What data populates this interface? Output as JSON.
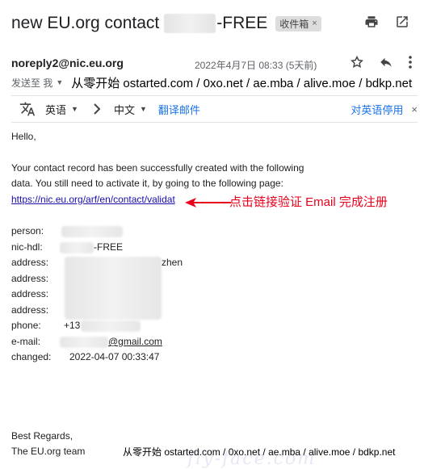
{
  "email": {
    "subject_prefix": "new EU.org contact",
    "subject_suffix": "-FREE",
    "inbox_chip": "收件箱",
    "chip_close": "×",
    "sender": "noreply2@nic.eu.org",
    "date": "2022年4月7日 08:33 (5天前)",
    "to_label": "发送至 我",
    "to_caret": "▼"
  },
  "watermark": {
    "top": "从零开始 ostarted.com / 0xo.net / ae.mba / alive.moe / bdkp.net",
    "bottom": "从零开始 ostarted.com / 0xo.net / ae.mba / alive.moe / bdkp.net",
    "faint": "fly-face.com"
  },
  "translate_bar": {
    "source_lang": "英语",
    "target_lang": "中文",
    "translate_link": "翻译邮件",
    "disable_link": "对英语停用",
    "close": "×"
  },
  "body": {
    "greeting": "Hello,",
    "para_line1": "Your contact record has been successfully created with the following",
    "para_line2": "data. You still need to activate it, by going to the following page:",
    "link": "https://nic.eu.org/arf/en/contact/validat",
    "annotation": "点击链接验证 Email 完成注册"
  },
  "fields": {
    "person_label": "person:",
    "nichdl_label": "nic-hdl:",
    "nichdl_value": "-FREE",
    "address_label": "address:",
    "address1_value": "zhen",
    "phone_label": "phone:",
    "phone_value": "+13",
    "email_label": "e-mail:",
    "email_value": "@gmail.com",
    "changed_label": "changed:",
    "changed_value": "2022-04-07 00:33:47"
  },
  "signature": {
    "regards": "Best Regards,",
    "team": "The EU.org team"
  }
}
